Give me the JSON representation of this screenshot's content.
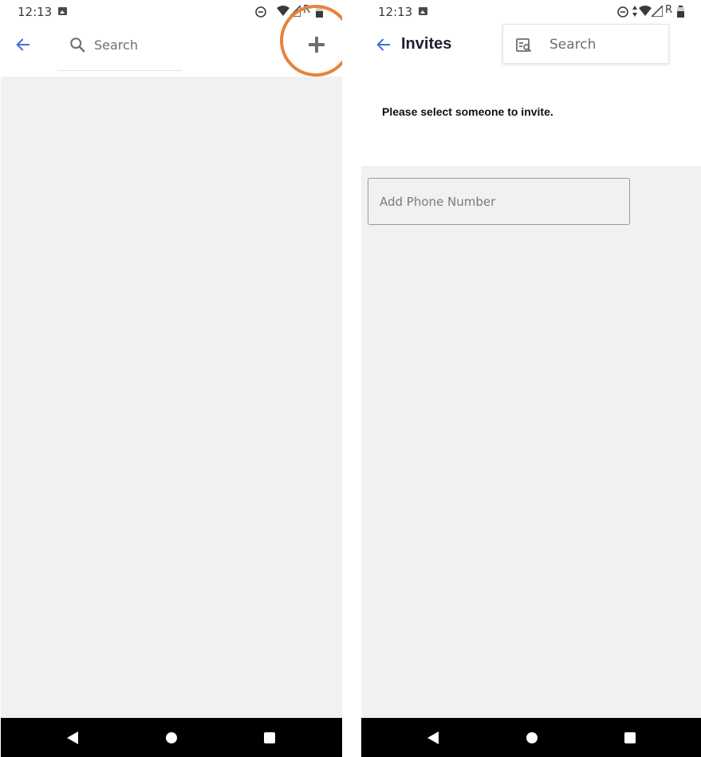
{
  "left_screen": {
    "status_bar": {
      "time": "12:13",
      "icons": [
        "image-icon",
        "do-not-disturb-icon",
        "wifi-icon",
        "signal-icon",
        "battery-icon"
      ],
      "roaming_label": "R"
    },
    "app_bar": {
      "back_icon": "arrow-left-icon",
      "search_icon": "search-icon",
      "search_label": "Search",
      "add_icon": "plus-icon"
    },
    "annotation": {
      "color": "#e8833a",
      "target": "add-button"
    },
    "nav_bar": {
      "icons": [
        "back-triangle-icon",
        "home-circle-icon",
        "recents-square-icon"
      ]
    }
  },
  "right_screen": {
    "status_bar": {
      "time": "12:13",
      "icons": [
        "image-icon",
        "do-not-disturb-icon",
        "data-arrows-icon",
        "wifi-icon",
        "signal-icon",
        "battery-icon"
      ],
      "roaming_label": "R"
    },
    "app_bar": {
      "back_icon": "arrow-left-icon",
      "title": "Invites",
      "search_icon": "contact-search-icon",
      "search_label": "Search"
    },
    "prompt": "Please select someone to invite.",
    "phone_field": {
      "placeholder": "Add Phone Number",
      "value": ""
    },
    "nav_bar": {
      "icons": [
        "back-triangle-icon",
        "home-circle-icon",
        "recents-square-icon"
      ]
    }
  },
  "colors": {
    "accent": "#3d6fe0",
    "background": "#f1f1f1",
    "nav_bar": "#000000",
    "annotation": "#e8833a"
  }
}
